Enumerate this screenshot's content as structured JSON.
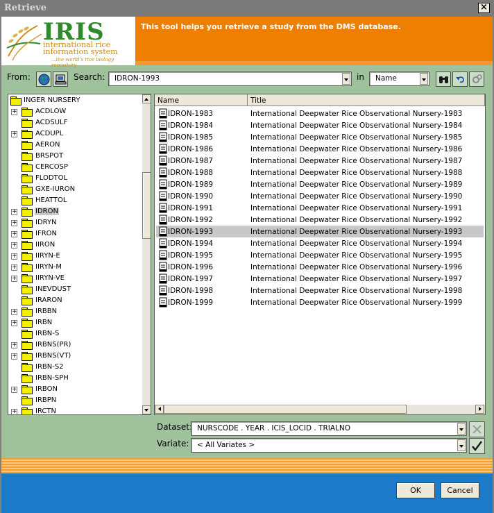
{
  "window": {
    "title": "Retrieve",
    "close_label": "×"
  },
  "banner": {
    "logo_text": "IRIS",
    "logo_line1": "international rice",
    "logo_line2": "information system",
    "logo_tagline": "...the world's rice biology repository",
    "message": "This tool helps you retrieve a study from the DMS database."
  },
  "toolbar": {
    "from_label": "From:",
    "search_label": "Search:",
    "search_value": "IDRON-1993",
    "in_label": "in",
    "in_value": "Name",
    "icons": [
      "globe-icon",
      "computer-icon",
      "binoculars-icon",
      "undo-icon",
      "gears-icon"
    ]
  },
  "tree": {
    "root": "INGER NURSERY",
    "selected": "IDRON",
    "items": [
      {
        "label": "ACDLOW",
        "expandable": true
      },
      {
        "label": "ACDSULF",
        "expandable": false
      },
      {
        "label": "ACDUPL",
        "expandable": true
      },
      {
        "label": "AERON",
        "expandable": false
      },
      {
        "label": "BRSPOT",
        "expandable": false
      },
      {
        "label": "CERCOSP",
        "expandable": false
      },
      {
        "label": "FLODTOL",
        "expandable": false
      },
      {
        "label": "GXE-IURON",
        "expandable": false
      },
      {
        "label": "HEATTOL",
        "expandable": false
      },
      {
        "label": "IDRON",
        "expandable": true
      },
      {
        "label": "IDRYN",
        "expandable": true
      },
      {
        "label": "IFRON",
        "expandable": true
      },
      {
        "label": "IIRON",
        "expandable": true
      },
      {
        "label": "IIRYN-E",
        "expandable": true
      },
      {
        "label": "IIRYN-M",
        "expandable": true
      },
      {
        "label": "IIRYN-VE",
        "expandable": true
      },
      {
        "label": "INEVDUST",
        "expandable": false
      },
      {
        "label": "IRARON",
        "expandable": false
      },
      {
        "label": "IRBBN",
        "expandable": true
      },
      {
        "label": "IRBN",
        "expandable": true
      },
      {
        "label": "IRBN-S",
        "expandable": false
      },
      {
        "label": "IRBNS(PR)",
        "expandable": true
      },
      {
        "label": "IRBNS(VT)",
        "expandable": true
      },
      {
        "label": "IRBN-S2",
        "expandable": false
      },
      {
        "label": "IRBN-SPH",
        "expandable": false
      },
      {
        "label": "IRBON",
        "expandable": true
      },
      {
        "label": "IRBPN",
        "expandable": false
      },
      {
        "label": "IRCTN",
        "expandable": true
      }
    ]
  },
  "table": {
    "columns": [
      "Name",
      "Title"
    ],
    "selected": "IDRON-1993",
    "rows": [
      {
        "name": "IDRON-1983",
        "title": "International Deepwater Rice Observational Nursery-1983"
      },
      {
        "name": "IDRON-1984",
        "title": "International Deepwater Rice Observational Nursery-1984"
      },
      {
        "name": "IDRON-1985",
        "title": "International Deepwater Rice Observational Nursery-1985"
      },
      {
        "name": "IDRON-1986",
        "title": "International Deepwater Rice Observational Nursery-1986"
      },
      {
        "name": "IDRON-1987",
        "title": "International Deepwater Rice Observational Nursery-1987"
      },
      {
        "name": "IDRON-1988",
        "title": "International Deepwater Rice Observational Nursery-1988"
      },
      {
        "name": "IDRON-1989",
        "title": "International Deepwater Rice Observational Nursery-1989"
      },
      {
        "name": "IDRON-1990",
        "title": "International Deepwater Rice Observational Nursery-1990"
      },
      {
        "name": "IDRON-1991",
        "title": "International Deepwater Rice Observational Nursery-1991"
      },
      {
        "name": "IDRON-1992",
        "title": "International Deepwater Rice Observational Nursery-1992"
      },
      {
        "name": "IDRON-1993",
        "title": "International Deepwater Rice Observational Nursery-1993"
      },
      {
        "name": "IDRON-1994",
        "title": "International Deepwater Rice Observational Nursery-1994"
      },
      {
        "name": "IDRON-1995",
        "title": "International Deepwater Rice Observational Nursery-1995"
      },
      {
        "name": "IDRON-1996",
        "title": "International Deepwater Rice Observational Nursery-1996"
      },
      {
        "name": "IDRON-1997",
        "title": "International Deepwater Rice Observational Nursery-1997"
      },
      {
        "name": "IDRON-1998",
        "title": "International Deepwater Rice Observational Nursery-1998"
      },
      {
        "name": "IDRON-1999",
        "title": "International Deepwater Rice Observational Nursery-1999"
      }
    ]
  },
  "bottom_fields": {
    "dataset_label": "Dataset:",
    "dataset_value": "NURSCODE . YEAR . ICIS_LOCID . TRIALNO",
    "variate_label": "Variate:",
    "variate_value": "< All Variates >"
  },
  "buttons": {
    "ok": "OK",
    "cancel": "Cancel"
  },
  "colors": {
    "accent": "#ef7f00",
    "panel": "#9fc19b",
    "footer": "#1c7cc9",
    "selection": "#c8c8c8"
  }
}
